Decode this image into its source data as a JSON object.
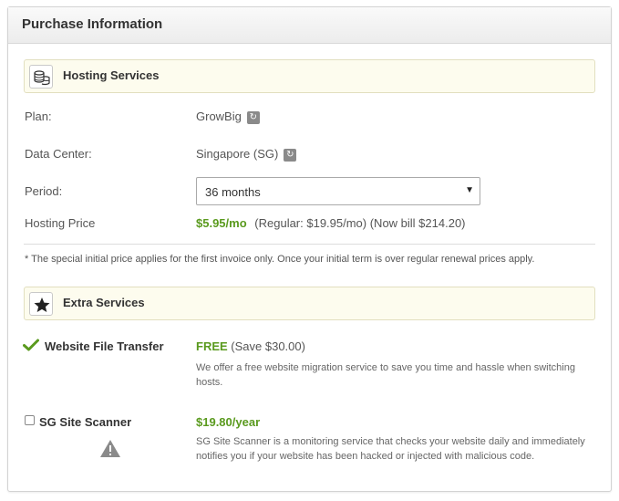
{
  "panel": {
    "title": "Purchase Information"
  },
  "hosting": {
    "section_title": "Hosting Services",
    "section_icon": "coins-stack-icon",
    "plan_label": "Plan:",
    "plan_value": "GrowBig",
    "datacenter_label": "Data Center:",
    "datacenter_value": "Singapore (SG)",
    "period_label": "Period:",
    "period_selected": "36 months",
    "price_label": "Hosting Price",
    "price_value": "$5.95/mo",
    "price_details": "(Regular: $19.95/mo) (Now bill $214.20)",
    "note": "* The special initial price applies for the first invoice only. Once your initial term is over regular renewal prices apply."
  },
  "extra": {
    "section_title": "Extra Services",
    "section_icon": "star-icon",
    "items": [
      {
        "name": "Website File Transfer",
        "price": "FREE",
        "price_note": "(Save $30.00)",
        "description": "We offer a free website migration service to save you time and hassle when switching hosts.",
        "icon": "checkmark-icon"
      },
      {
        "name": "SG Site Scanner",
        "price": "$19.80/year",
        "price_note": "",
        "description": "SG Site Scanner is a monitoring service that checks your website daily and immediately notifies you if your website has been hacked or injected with malicious code.",
        "icon": "warning-icon",
        "checked": false
      }
    ]
  },
  "colors": {
    "accent_green": "#5a9a1e",
    "section_bg": "#fdfcee",
    "header_bg": "#efefef"
  }
}
